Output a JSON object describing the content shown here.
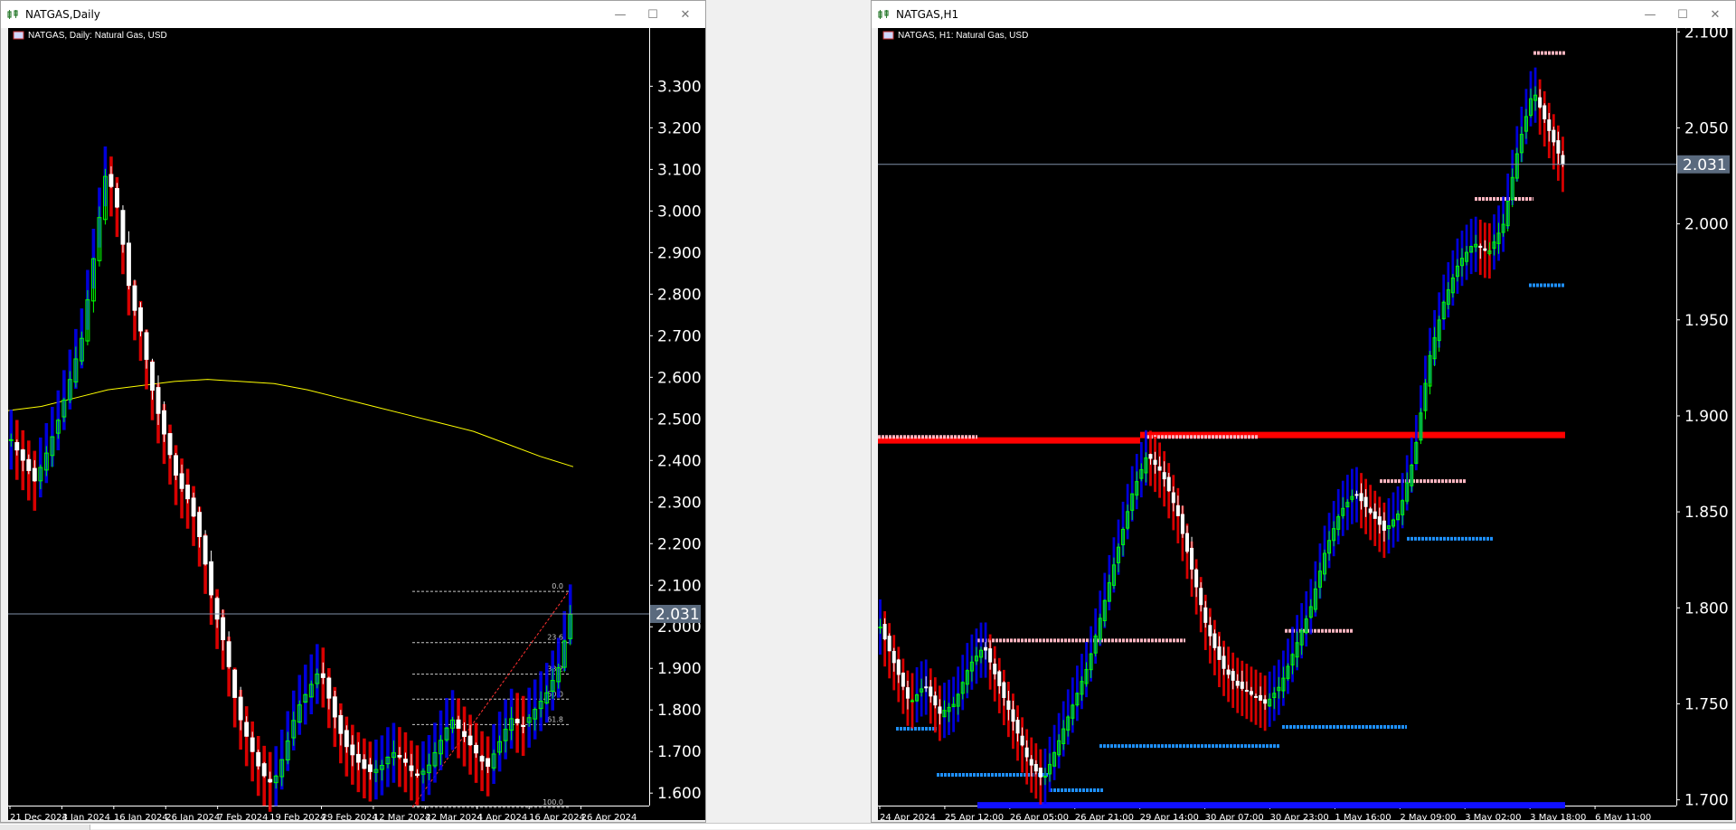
{
  "windows": {
    "left": {
      "title": "NATGAS,Daily",
      "symbol_label": "NATGAS, Daily:  Natural Gas, USD"
    },
    "right": {
      "title": "NATGAS,H1",
      "symbol_label": "NATGAS, H1:  Natural Gas, USD"
    }
  },
  "window_buttons": {
    "minimize": "—",
    "maximize": "☐",
    "close": "✕"
  },
  "colors": {
    "background": "#000000",
    "bull_candle": "#00ff00",
    "bear_candle": "#ffffff",
    "trend_up": "#0000ff",
    "trend_down": "#ff0000",
    "ma": "#ffff00",
    "price_line": "#7f8fa8",
    "resistance": "#ffb6c1",
    "support": "#1e90ff",
    "fib": "#c8c8c8"
  },
  "chart_data": [
    {
      "type": "candlestick",
      "symbol": "NATGAS",
      "timeframe": "Daily",
      "current_price": "2.031",
      "y_ticks": [
        "3.300",
        "3.200",
        "3.100",
        "3.000",
        "2.900",
        "2.800",
        "2.700",
        "2.600",
        "2.500",
        "2.400",
        "2.300",
        "2.200",
        "2.100",
        "2.000",
        "1.900",
        "1.800",
        "1.700",
        "1.600"
      ],
      "x_ticks": [
        "21 Dec 2023",
        "4 Jan 2024",
        "16 Jan 2024",
        "26 Jan 2024",
        "7 Feb 2024",
        "19 Feb 2024",
        "29 Feb 2024",
        "12 Mar 2024",
        "22 Mar 2024",
        "4 Apr 2024",
        "16 Apr 2024",
        "26 Apr 2024"
      ],
      "ylim": [
        1.57,
        3.44
      ],
      "ma_values": [
        2.52,
        2.53,
        2.55,
        2.57,
        2.58,
        2.59,
        2.595,
        2.59,
        2.585,
        2.57,
        2.55,
        2.53,
        2.51,
        2.49,
        2.47,
        2.44,
        2.41,
        2.385
      ],
      "fib_levels": [
        {
          "label": "0.0",
          "value": 2.085
        },
        {
          "label": "23.6",
          "value": 1.962
        },
        {
          "label": "38.2",
          "value": 1.886
        },
        {
          "label": "50.0",
          "value": 1.826
        },
        {
          "label": "61.8",
          "value": 1.765
        },
        {
          "label": "100.0",
          "value": 1.566
        }
      ],
      "close_series": [
        2.45,
        2.4,
        2.35,
        2.42,
        2.5,
        2.6,
        2.7,
        2.9,
        3.1,
        3.0,
        2.8,
        2.7,
        2.55,
        2.45,
        2.35,
        2.3,
        2.2,
        2.05,
        1.95,
        1.8,
        1.72,
        1.65,
        1.62,
        1.7,
        1.8,
        1.85,
        1.9,
        1.8,
        1.72,
        1.68,
        1.65,
        1.66,
        1.7,
        1.68,
        1.64,
        1.66,
        1.72,
        1.78,
        1.74,
        1.7,
        1.66,
        1.72,
        1.78,
        1.76,
        1.8,
        1.84,
        1.9,
        2.03
      ]
    },
    {
      "type": "candlestick",
      "symbol": "NATGAS",
      "timeframe": "H1",
      "current_price": "2.031",
      "y_ticks": [
        "2.100",
        "2.050",
        "2.000",
        "1.950",
        "1.900",
        "1.850",
        "1.800",
        "1.750",
        "1.700"
      ],
      "x_ticks": [
        "24 Apr 2024",
        "25 Apr 12:00",
        "26 Apr 05:00",
        "26 Apr 21:00",
        "29 Apr 14:00",
        "30 Apr 07:00",
        "30 Apr 23:00",
        "1 May 16:00",
        "2 May 09:00",
        "3 May 02:00",
        "3 May 18:00",
        "6 May 11:00"
      ],
      "ylim": [
        1.697,
        2.102
      ],
      "resistance_level": 1.89,
      "support_level": 1.7,
      "close_series": [
        1.79,
        1.77,
        1.75,
        1.76,
        1.745,
        1.75,
        1.77,
        1.78,
        1.76,
        1.74,
        1.72,
        1.71,
        1.73,
        1.75,
        1.77,
        1.8,
        1.83,
        1.86,
        1.88,
        1.87,
        1.85,
        1.82,
        1.79,
        1.77,
        1.76,
        1.755,
        1.75,
        1.76,
        1.78,
        1.8,
        1.83,
        1.85,
        1.86,
        1.85,
        1.84,
        1.85,
        1.88,
        1.93,
        1.96,
        1.98,
        1.99,
        1.985,
        2.0,
        2.04,
        2.07,
        2.05,
        2.031
      ]
    }
  ]
}
